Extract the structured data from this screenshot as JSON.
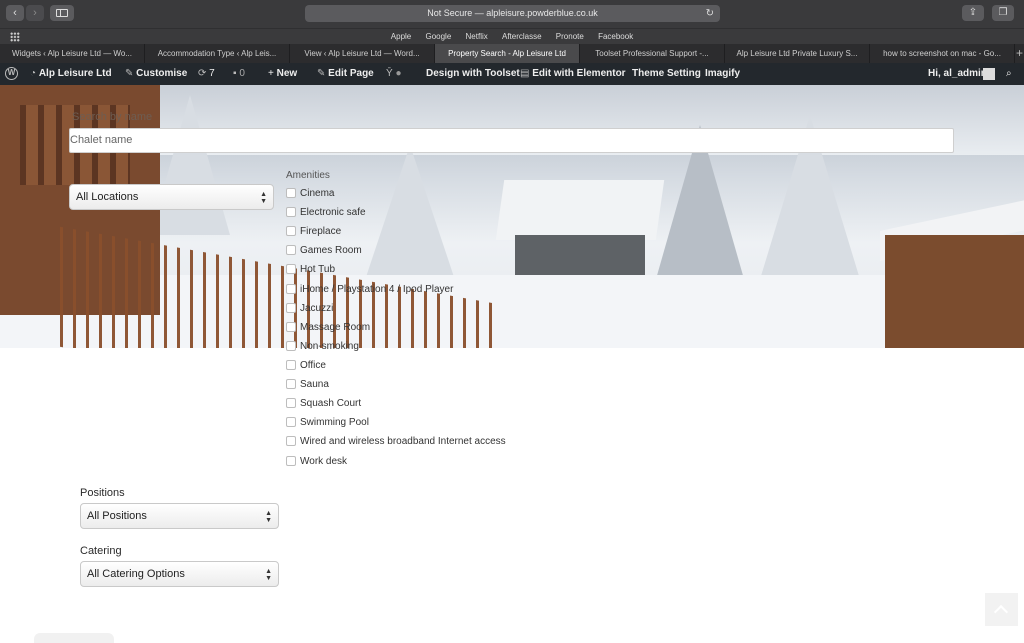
{
  "browser": {
    "address": "Not Secure — alpleisure.powderblue.co.uk",
    "favorites": [
      "Apple",
      "Google",
      "Netflix",
      "Afterclasse",
      "Pronote",
      "Facebook"
    ],
    "tabs": [
      {
        "label": "Widgets ‹ Alp Leisure Ltd — Wo..."
      },
      {
        "label": "Accommodation Type ‹ Alp Leis..."
      },
      {
        "label": "View ‹ Alp Leisure Ltd — Word..."
      },
      {
        "label": "Property Search - Alp Leisure Ltd"
      },
      {
        "label": "Toolset Professional Support -..."
      },
      {
        "label": "Alp Leisure Ltd Private Luxury S..."
      },
      {
        "label": "how to screenshot on mac - Go..."
      }
    ],
    "active_tab": 3,
    "new_tab": "+"
  },
  "adminbar": {
    "site": "Alp Leisure Ltd",
    "customise": "Customise",
    "updates": "7",
    "comments": "0",
    "new": "New",
    "edit_page": "Edit Page",
    "design_toolset": "Design with Toolset",
    "elementor": "Edit with Elementor",
    "theme_setting": "Theme Setting",
    "imagify": "Imagify",
    "greeting": "Hi, al_admin"
  },
  "search": {
    "search_label": "Search by name",
    "name_placeholder": "Chalet name",
    "locations_value": "All Locations",
    "amenities_label": "Amenities",
    "amenities": [
      "Cinema",
      "Electronic safe",
      "Fireplace",
      "Games Room",
      "Hot Tub",
      "iHome / Playstation 4 / Ipod Player",
      "Jacuzzi",
      "Massage Room",
      "Non-smoking",
      "Office",
      "Sauna",
      "Squash Court",
      "Swimming Pool",
      "Wired and wireless broadband Internet access",
      "Work desk"
    ],
    "positions_label": "Positions",
    "positions_value": "All Positions",
    "catering_label": "Catering",
    "catering_value": "All Catering Options"
  }
}
